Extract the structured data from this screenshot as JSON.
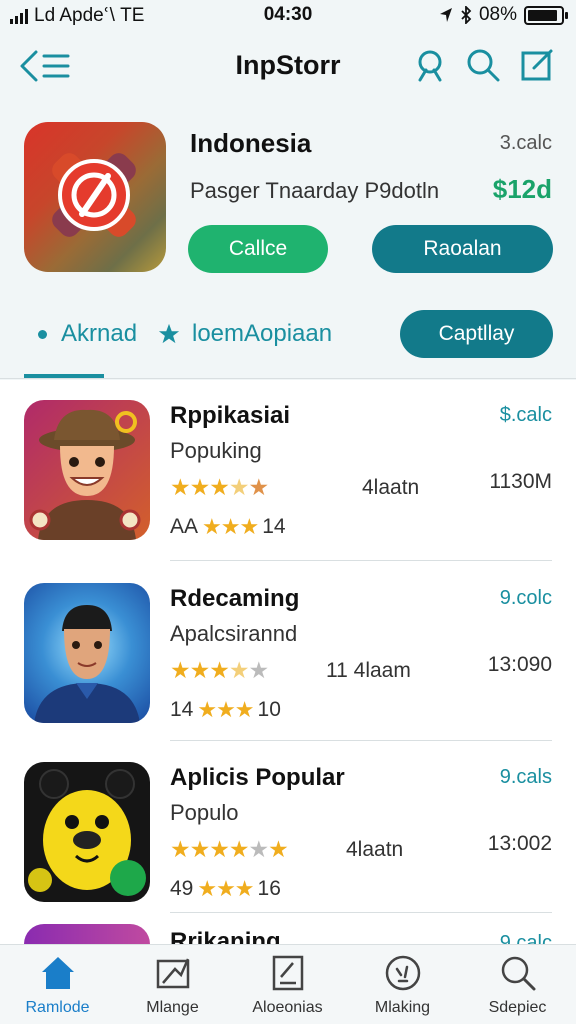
{
  "status_bar": {
    "carrier": "Ld Apdeՙ\\ TE",
    "time": "04:30",
    "battery": "08%",
    "battery_level": 0.9
  },
  "header": {
    "title": "InpStorr"
  },
  "featured": {
    "name": "Indonesia",
    "price_label": "3.calc",
    "subtitle": "Pasger Tnaarday P9dotln",
    "price": "$12d",
    "primary_button": "Callce",
    "secondary_button": "Raoalan"
  },
  "tabs": {
    "tab1": "Akrnad",
    "tab2": "loemAopiaan",
    "action_button": "Captllay"
  },
  "apps": [
    {
      "name": "Rppikasiai",
      "category": "Popuking",
      "price": "$.calc",
      "rating": 3.5,
      "meta": "4laatn",
      "size": "1130M",
      "rating_count": "AA",
      "rating_tail": "14",
      "small_stars": 3
    },
    {
      "name": "Rdecaming",
      "category": "Apalcsirannd",
      "price": "9.colc",
      "rating": 3.5,
      "meta": "11 4laam",
      "size": "13:090",
      "rating_count": "14",
      "rating_tail": "10",
      "small_stars": 3
    },
    {
      "name": "Aplicis Popular",
      "category": "Populo",
      "price": "9.cals",
      "rating": 4,
      "meta": "4laatn",
      "size": "13:002",
      "rating_count": "49",
      "rating_tail": "16",
      "small_stars": 3
    }
  ],
  "partial_app": {
    "name": "Rrikaning",
    "price": "9.calc"
  },
  "bottom_nav": [
    {
      "label": "Ramlode",
      "icon": "home-icon",
      "active": true
    },
    {
      "label": "Mlange",
      "icon": "map-icon",
      "active": false
    },
    {
      "label": "Aloeonias",
      "icon": "edit-doc-icon",
      "active": false
    },
    {
      "label": "Mlaking",
      "icon": "speech-icon",
      "active": false
    },
    {
      "label": "Sdepiec",
      "icon": "search-icon",
      "active": false
    }
  ],
  "colors": {
    "accent_teal": "#127a8a",
    "accent_green": "#1fb36f",
    "link_teal": "#1a8fa0",
    "star": "#f0ad1e",
    "active_nav": "#1a7ec9"
  }
}
